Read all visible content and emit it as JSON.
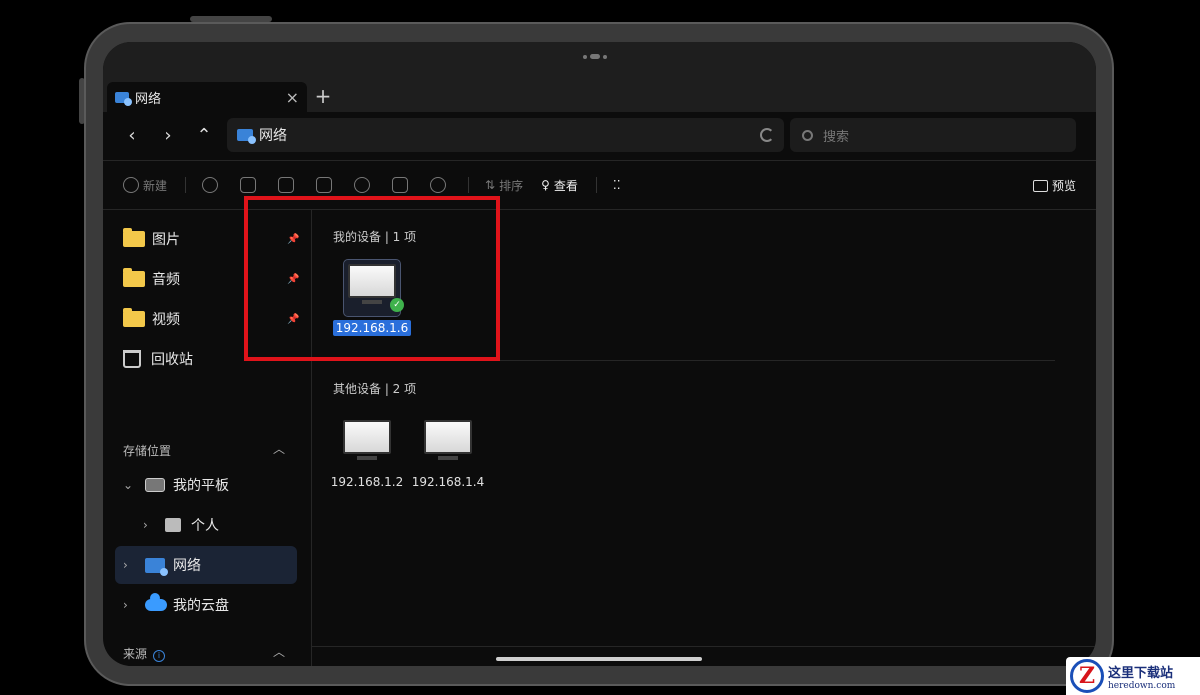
{
  "tab": {
    "title": "网络",
    "close": "×",
    "new": "+"
  },
  "nav": {
    "back": "‹",
    "forward": "›",
    "up": "⌃"
  },
  "address": {
    "path": "网络"
  },
  "search": {
    "placeholder": "搜索"
  },
  "toolbar": {
    "new_label": "新建",
    "sort_label": "排序",
    "view_label": "查看",
    "preview_label": "预览"
  },
  "sidebar": {
    "quick": [
      {
        "label": "图片"
      },
      {
        "label": "音频"
      },
      {
        "label": "视频"
      },
      {
        "label": "回收站"
      }
    ],
    "storage_header": "存储位置",
    "storage": [
      {
        "label": "我的平板"
      },
      {
        "label": "个人"
      },
      {
        "label": "网络"
      },
      {
        "label": "我的云盘"
      }
    ],
    "source_header": "来源"
  },
  "groups": {
    "mine": {
      "header": "我的设备 | 1 项",
      "devices": [
        "192.168.1.6"
      ]
    },
    "other": {
      "header": "其他设备 | 2 项",
      "devices": [
        "192.168.1.2",
        "192.168.1.4"
      ]
    }
  },
  "watermark": {
    "logo": "Z",
    "title": "这里下载站",
    "url": "heredown.com"
  },
  "colors": {
    "accent": "#2a6fdb",
    "highlight_box": "#e0131a",
    "folder": "#f3c84a"
  }
}
